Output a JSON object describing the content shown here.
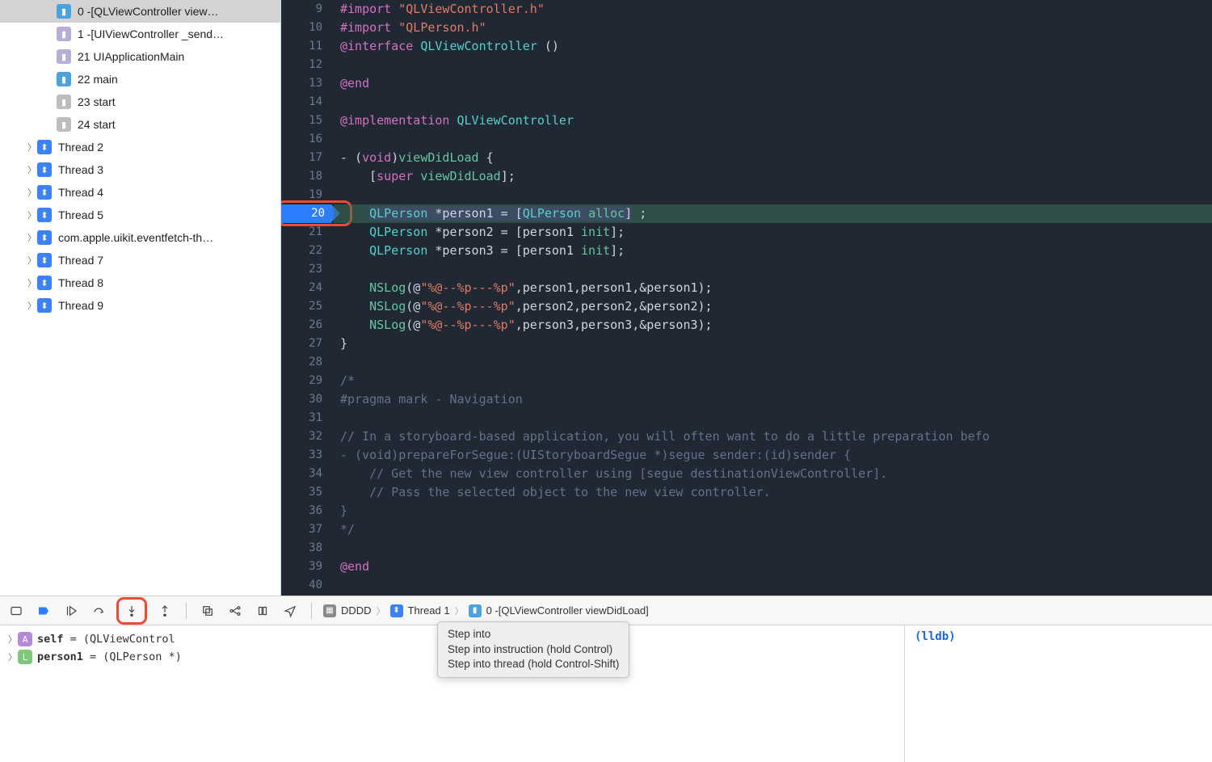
{
  "sidebar": {
    "frames": [
      {
        "idx": "0",
        "label": "-[QLViewController view…",
        "icon": "user",
        "selected": true
      },
      {
        "idx": "1",
        "label": "-[UIViewController _send…",
        "icon": "sys"
      },
      {
        "idx": "21",
        "label": "UIApplicationMain",
        "icon": "sys"
      },
      {
        "idx": "22",
        "label": "main",
        "icon": "user"
      },
      {
        "idx": "23",
        "label": "start",
        "icon": "gray"
      },
      {
        "idx": "24",
        "label": "start",
        "icon": "gray"
      }
    ],
    "threads": [
      "Thread 2",
      "Thread 3",
      "Thread 4",
      "Thread 5",
      "com.apple.uikit.eventfetch-th…",
      "Thread 7",
      "Thread 8",
      "Thread 9"
    ]
  },
  "code": {
    "startLine": 9,
    "endLine": 40,
    "breakpointLine": 20,
    "lines": {
      "9": {
        "html": "<span class='c-kw'>#import</span> <span class='c-str'>\"QLViewController.h\"</span>"
      },
      "10": {
        "html": "<span class='c-kw'>#import</span> <span class='c-str'>\"QLPerson.h\"</span>"
      },
      "11": {
        "html": "<span class='c-kw'>@interface</span> <span class='c-type'>QLViewController</span> <span class='c-id'>()</span>"
      },
      "12": {
        "html": ""
      },
      "13": {
        "html": "<span class='c-kw'>@end</span>"
      },
      "14": {
        "html": ""
      },
      "15": {
        "html": "<span class='c-kw'>@implementation</span> <span class='c-type'>QLViewController</span>"
      },
      "16": {
        "html": ""
      },
      "17": {
        "html": "<span class='c-id'>- </span>(<span class='c-kw'>void</span>)<span class='c-func'>viewDidLoad</span> {"
      },
      "18": {
        "html": "    [<span class='c-kw'>super</span> <span class='c-func'>viewDidLoad</span>];"
      },
      "19": {
        "html": ""
      },
      "20": {
        "html": "    <span class='sel'><span class='c-type'>QLPerson</span> *person1 = [<span class='c-type'>QLPerson</span> <span class='c-func'>alloc</span>]</span> ;"
      },
      "21": {
        "html": "    <span class='c-type'>QLPerson</span> *person2 = [person1 <span class='c-func'>init</span>];"
      },
      "22": {
        "html": "    <span class='c-type'>QLPerson</span> *person3 = [person1 <span class='c-func'>init</span>];"
      },
      "23": {
        "html": ""
      },
      "24": {
        "html": "    <span class='c-func'>NSLog</span>(@<span class='c-str'>\"%@--%p---%p\"</span>,person1,person1,&person1);"
      },
      "25": {
        "html": "    <span class='c-func'>NSLog</span>(@<span class='c-str'>\"%@--%p---%p\"</span>,person2,person2,&person2);"
      },
      "26": {
        "html": "    <span class='c-func'>NSLog</span>(@<span class='c-str'>\"%@--%p---%p\"</span>,person3,person3,&person3);"
      },
      "27": {
        "html": "}"
      },
      "28": {
        "html": ""
      },
      "29": {
        "html": "<span class='c-cmt'>/*</span>"
      },
      "30": {
        "html": "<span class='c-cmt'>#pragma mark - Navigation</span>"
      },
      "31": {
        "html": ""
      },
      "32": {
        "html": "<span class='c-cmt'>// In a storyboard-based application, you will often want to do a little preparation befo</span>"
      },
      "33": {
        "html": "<span class='c-cmt'>- (void)prepareForSegue:(UIStoryboardSegue *)segue sender:(id)sender {</span>"
      },
      "34": {
        "html": "<span class='c-cmt'>    // Get the new view controller using [segue destinationViewController].</span>"
      },
      "35": {
        "html": "<span class='c-cmt'>    // Pass the selected object to the new view controller.</span>"
      },
      "36": {
        "html": "<span class='c-cmt'>}</span>"
      },
      "37": {
        "html": "<span class='c-cmt'>*/</span>"
      },
      "38": {
        "html": ""
      },
      "39": {
        "html": "<span class='c-kw'>@end</span>"
      },
      "40": {
        "html": ""
      }
    }
  },
  "debugbar": {
    "breadcrumb": {
      "project": "DDDD",
      "thread": "Thread 1",
      "frame": "0 -[QLViewController viewDidLoad]"
    }
  },
  "tooltip": {
    "l1": "Step into",
    "l2": "Step into instruction (hold Control)",
    "l3": "Step into thread (hold Control-Shift)"
  },
  "vars": {
    "rows": [
      {
        "icon": "A",
        "name": "self",
        "rest": " = (QLViewControl"
      },
      {
        "icon": "L",
        "name": "person1",
        "rest": " = (QLPerson *)"
      }
    ]
  },
  "lldb": "(lldb)"
}
